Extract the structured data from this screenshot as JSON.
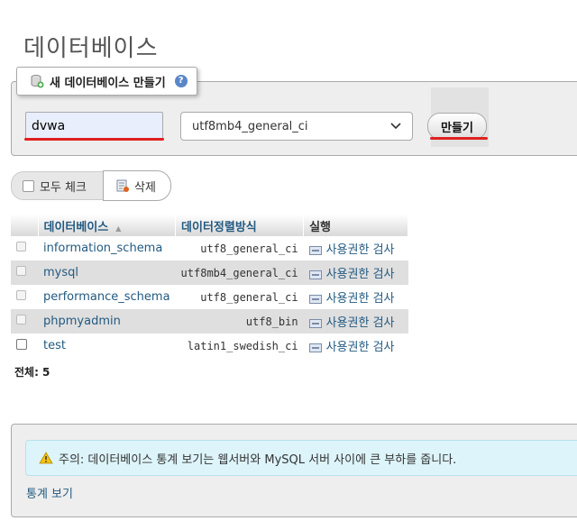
{
  "page": {
    "title": "데이터베이스"
  },
  "create_db": {
    "legend": "새 데이터베이스 만들기",
    "help_icon": "?",
    "name_value": "dvwa",
    "collation_value": "utf8mb4_general_ci",
    "create_label": "만들기"
  },
  "actions": {
    "check_all_label": "모두 체크",
    "delete_label": "삭제"
  },
  "table": {
    "headers": {
      "database": "데이터베이스",
      "collation": "데이터정렬방식",
      "action": "실행"
    },
    "rows": [
      {
        "name": "information_schema",
        "collation": "utf8_general_ci",
        "action": "사용권한 검사"
      },
      {
        "name": "mysql",
        "collation": "utf8mb4_general_ci",
        "action": "사용권한 검사"
      },
      {
        "name": "performance_schema",
        "collation": "utf8_general_ci",
        "action": "사용권한 검사"
      },
      {
        "name": "phpmyadmin",
        "collation": "utf8_bin",
        "action": "사용권한 검사"
      },
      {
        "name": "test",
        "collation": "latin1_swedish_ci",
        "action": "사용권한 검사"
      }
    ],
    "total": "전체: 5"
  },
  "notice": {
    "text": "주의: 데이터베이스 통계 보기는 웹서버와 MySQL 서버 사이에 큰 부하를 줍니다.",
    "link": "통계 보기"
  },
  "colors": {
    "link": "#235a81",
    "highlight": "#e02020",
    "notice_bg": "#ddf4fa"
  }
}
